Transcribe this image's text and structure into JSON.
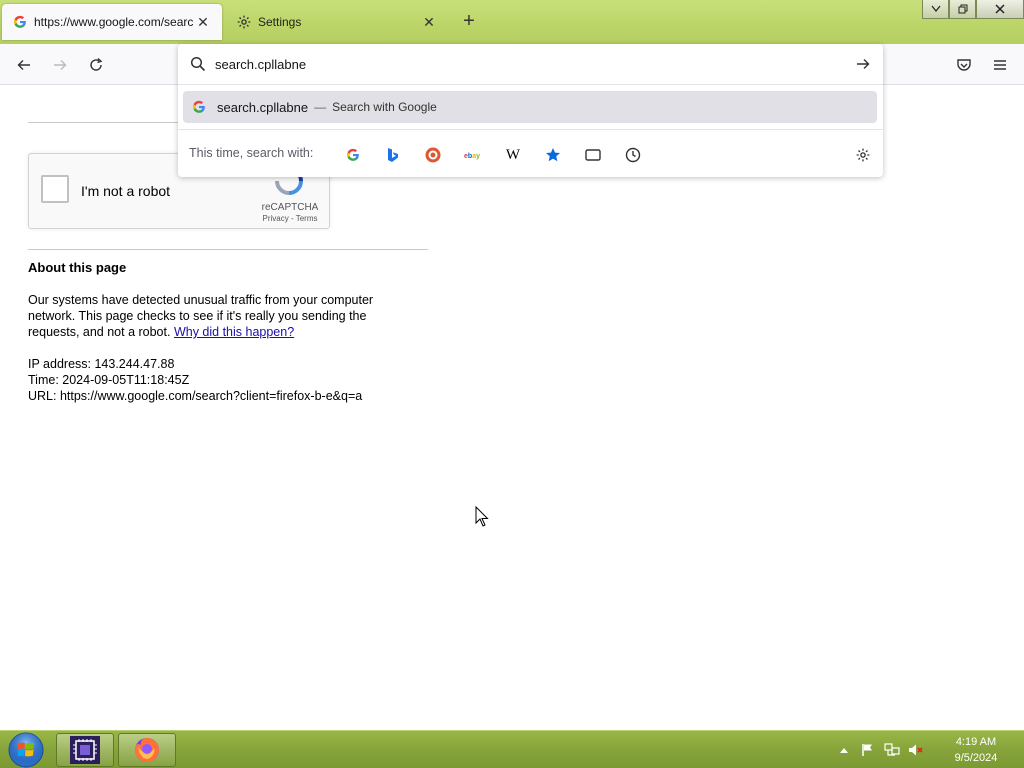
{
  "browser": {
    "tabs": [
      {
        "title": "https://www.google.com/search?c",
        "favicon": "google-g-icon",
        "active": true
      },
      {
        "title": "Settings",
        "favicon": "gear-icon",
        "active": false
      }
    ],
    "new_tab": "+"
  },
  "urlbar": {
    "value": "search.cpllabne",
    "suggestion": {
      "text": "search.cpllabne",
      "separator": "—",
      "action": "Search with Google"
    },
    "oneoff_label": "This time, search with:",
    "engines": [
      "google-icon",
      "bing-icon",
      "duckduckgo-icon",
      "ebay-icon",
      "wikipedia-icon",
      "bookmarks-icon",
      "tabs-icon",
      "history-icon",
      "search-settings-icon"
    ]
  },
  "page": {
    "captcha_label": "I'm not a robot",
    "recaptcha_name": "reCAPTCHA",
    "recaptcha_links": "Privacy - Terms",
    "about_title": "About this page",
    "about_text": "Our systems have detected unusual traffic from your computer network. This page checks to see if it's really you sending the requests, and not a robot.",
    "why_link": "Why did this happen?",
    "ip_line": "IP address: 143.244.47.88",
    "time_line": "Time: 2024-09-05T11:18:45Z",
    "url_line": "URL: https://www.google.com/search?client=firefox-b-e&q=a"
  },
  "taskbar": {
    "time": "4:19 AM",
    "date": "9/5/2024"
  },
  "colors": {
    "taskbar_green": "#86a43a",
    "tabstrip_green": "#bcd569",
    "link_blue": "#1a0dab"
  }
}
